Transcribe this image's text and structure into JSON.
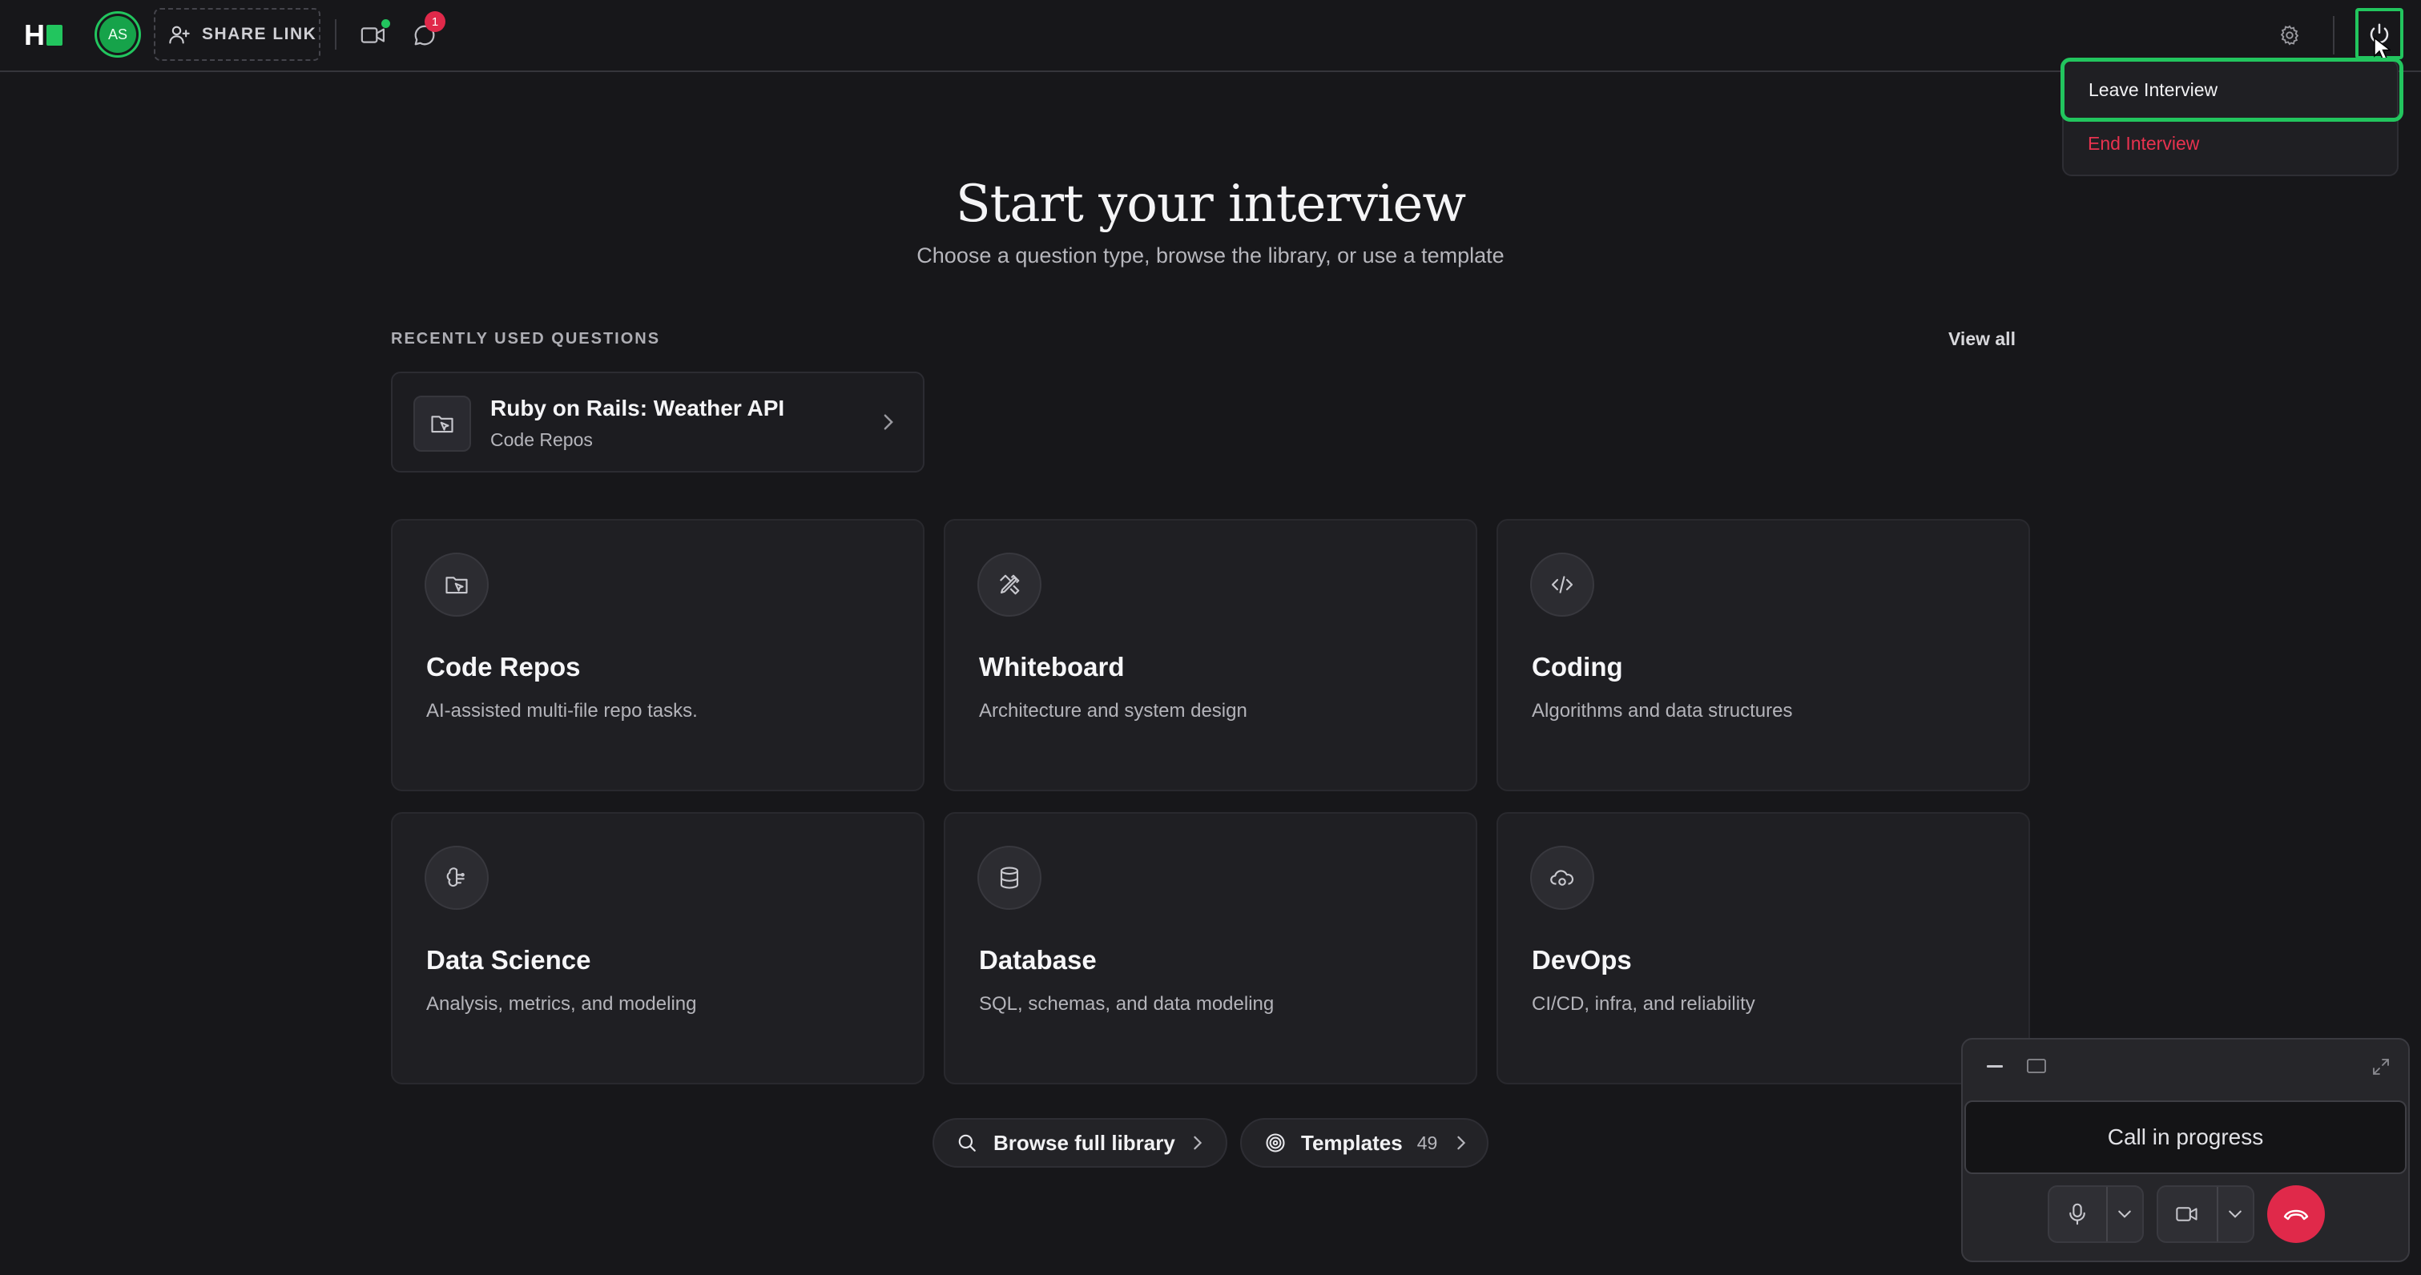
{
  "header": {
    "logo_letter": "H",
    "avatar_initials": "AS",
    "share_label": "SHARE LINK",
    "notification_count": "1"
  },
  "menu": {
    "leave_label": "Leave Interview",
    "end_label": "End Interview"
  },
  "hero": {
    "title": "Start your interview",
    "subtitle": "Choose a question type, browse the library, or use a template"
  },
  "recent": {
    "section_label": "RECENTLY USED QUESTIONS",
    "view_all_label": "View all",
    "item": {
      "title": "Ruby on Rails: Weather API",
      "subtitle": "Code Repos"
    }
  },
  "types": [
    {
      "title": "Code Repos",
      "desc": "AI-assisted multi-file repo tasks.",
      "icon": "folder-cursor-icon"
    },
    {
      "title": "Whiteboard",
      "desc": "Architecture and system design",
      "icon": "pencil-ruler-icon"
    },
    {
      "title": "Coding",
      "desc": "Algorithms and data structures",
      "icon": "code-icon"
    },
    {
      "title": "Data Science",
      "desc": "Analysis, metrics, and modeling",
      "icon": "brain-icon"
    },
    {
      "title": "Database",
      "desc": "SQL, schemas, and data modeling",
      "icon": "database-icon"
    },
    {
      "title": "DevOps",
      "desc": "CI/CD, infra, and reliability",
      "icon": "cloud-cog-icon"
    }
  ],
  "actions": {
    "browse_label": "Browse full library",
    "templates_label": "Templates",
    "templates_count": "49"
  },
  "call": {
    "status": "Call in progress"
  },
  "colors": {
    "background": "#17171a",
    "accent": "#22c55e",
    "danger": "#e0294a"
  }
}
